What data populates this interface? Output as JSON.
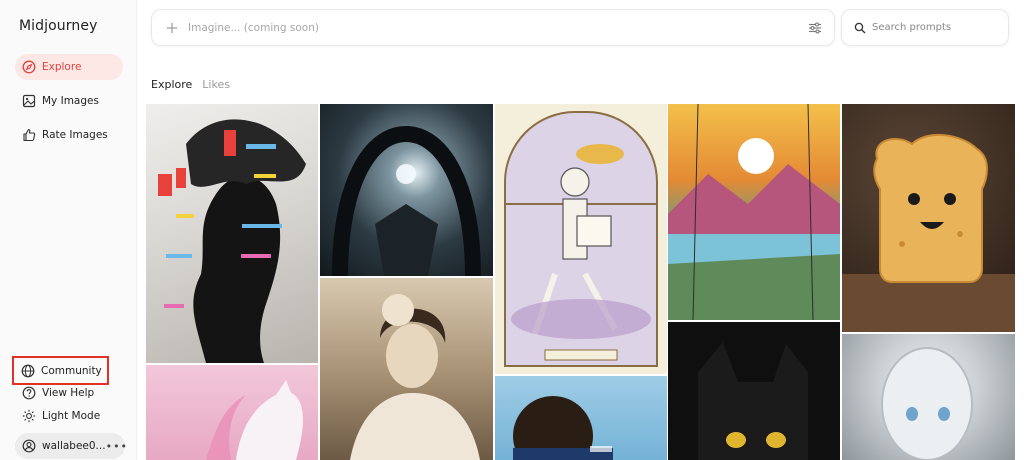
{
  "brand": "Midjourney",
  "sidebar": {
    "items": [
      {
        "label": "Explore",
        "icon": "compass-icon"
      },
      {
        "label": "My Images",
        "icon": "image-icon"
      },
      {
        "label": "Rate Images",
        "icon": "thumbs-up-icon"
      }
    ],
    "bottom": [
      {
        "label": "Community",
        "icon": "globe-icon"
      },
      {
        "label": "View Help",
        "icon": "help-icon"
      },
      {
        "label": "Light Mode",
        "icon": "sun-icon"
      }
    ],
    "user": {
      "name": "wallabee0...",
      "more": "•••"
    }
  },
  "imagine": {
    "placeholder": "Imagine... (coming soon)"
  },
  "search": {
    "placeholder": "Search prompts"
  },
  "tabs": [
    {
      "label": "Explore",
      "active": true
    },
    {
      "label": "Likes",
      "active": false
    }
  ],
  "colors": {
    "accent": "#e0413b",
    "accent_bg": "#fde8e6",
    "highlight_box": "#e0312b"
  }
}
